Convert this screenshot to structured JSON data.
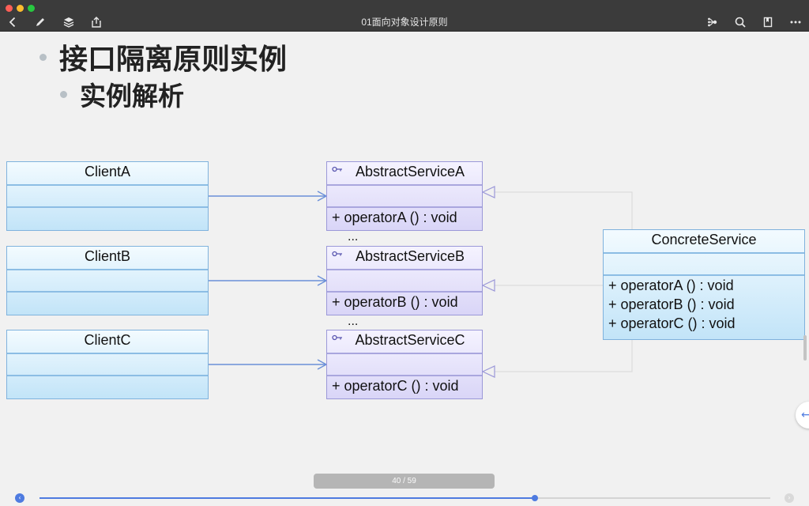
{
  "window": {
    "title": "01面向对象设计原则"
  },
  "toolbar": {
    "left_icons": [
      "back-icon",
      "pencil-icon",
      "layers-icon",
      "share-icon"
    ],
    "right_icons": [
      "mindmap-icon",
      "search-icon",
      "bookmark-icon",
      "more-icon"
    ]
  },
  "slide": {
    "bullet_1": "接口隔离原则实例",
    "bullet_2": "实例解析"
  },
  "uml": {
    "clients": [
      {
        "name": "ClientA"
      },
      {
        "name": "ClientB"
      },
      {
        "name": "ClientC"
      }
    ],
    "abstract_services": [
      {
        "name": "AbstractServiceA",
        "operation": "+  operatorA ()  : void"
      },
      {
        "name": "AbstractServiceB",
        "operation": "+  operatorB ()  : void"
      },
      {
        "name": "AbstractServiceC",
        "operation": "+  operatorC ()  : void"
      }
    ],
    "ellipsis": "...",
    "concrete": {
      "name": "ConcreteService",
      "operations": [
        "+  operatorA ()  : void",
        "+  operatorB ()  : void",
        "+  operatorC ()  : void"
      ]
    }
  },
  "pagination": {
    "label": "40 / 59",
    "current": 40,
    "total": 59,
    "progress_fraction": 0.678
  },
  "colors": {
    "accent": "#4e7be0",
    "titlebar": "#3b3b3b",
    "client_fill": "#c2e4f8",
    "abstract_fill": "#d9d5f7"
  },
  "side_button_icon": "arrow-left-icon"
}
